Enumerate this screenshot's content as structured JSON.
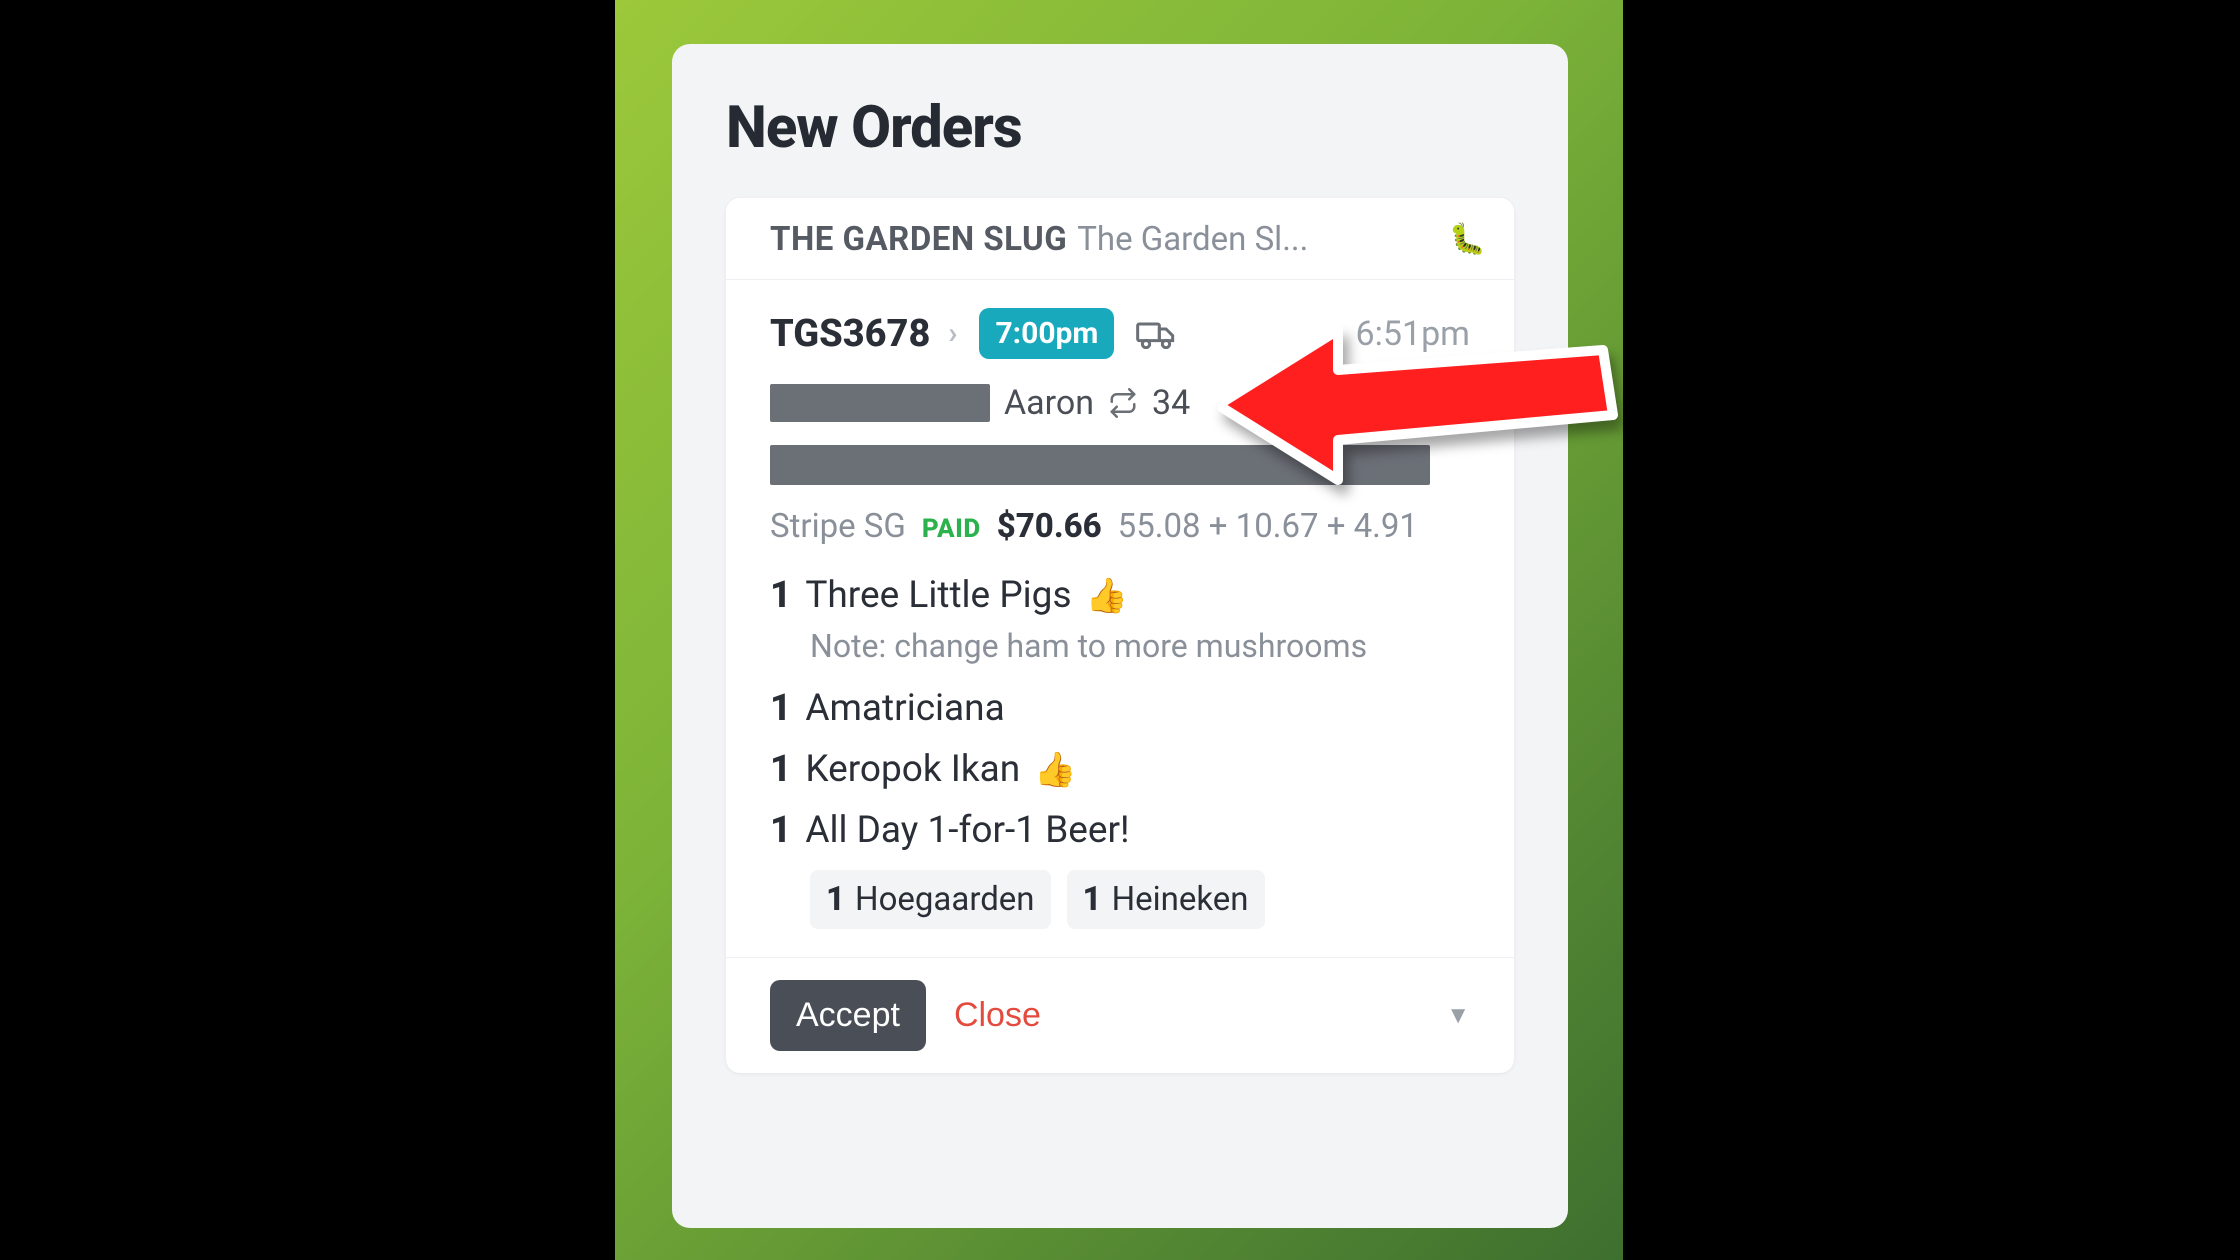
{
  "modal": {
    "title": "New Orders"
  },
  "merchant": {
    "name": "THE GARDEN SLUG",
    "sub": "The Garden Sl...",
    "icon": "🐛"
  },
  "order": {
    "id": "TGS3678",
    "scheduled": "7:00pm",
    "placed": "6:51pm",
    "customer": "Aaron",
    "repeat_count": "34"
  },
  "payment": {
    "processor": "Stripe SG",
    "status": "PAID",
    "total": "$70.66",
    "breakdown": "55.08 + 10.67 + 4.91"
  },
  "items": [
    {
      "qty": "1",
      "name": "Three Little Pigs",
      "thumb": "👍",
      "note": "Note: change ham to more mushrooms"
    },
    {
      "qty": "1",
      "name": "Amatriciana"
    },
    {
      "qty": "1",
      "name": "Keropok Ikan",
      "thumb": "👍"
    },
    {
      "qty": "1",
      "name": "All Day 1-for-1 Beer!",
      "subs": [
        {
          "qty": "1",
          "name": "Hoegaarden"
        },
        {
          "qty": "1",
          "name": "Heineken"
        }
      ]
    }
  ],
  "footer": {
    "accept": "Accept",
    "close": "Close"
  }
}
